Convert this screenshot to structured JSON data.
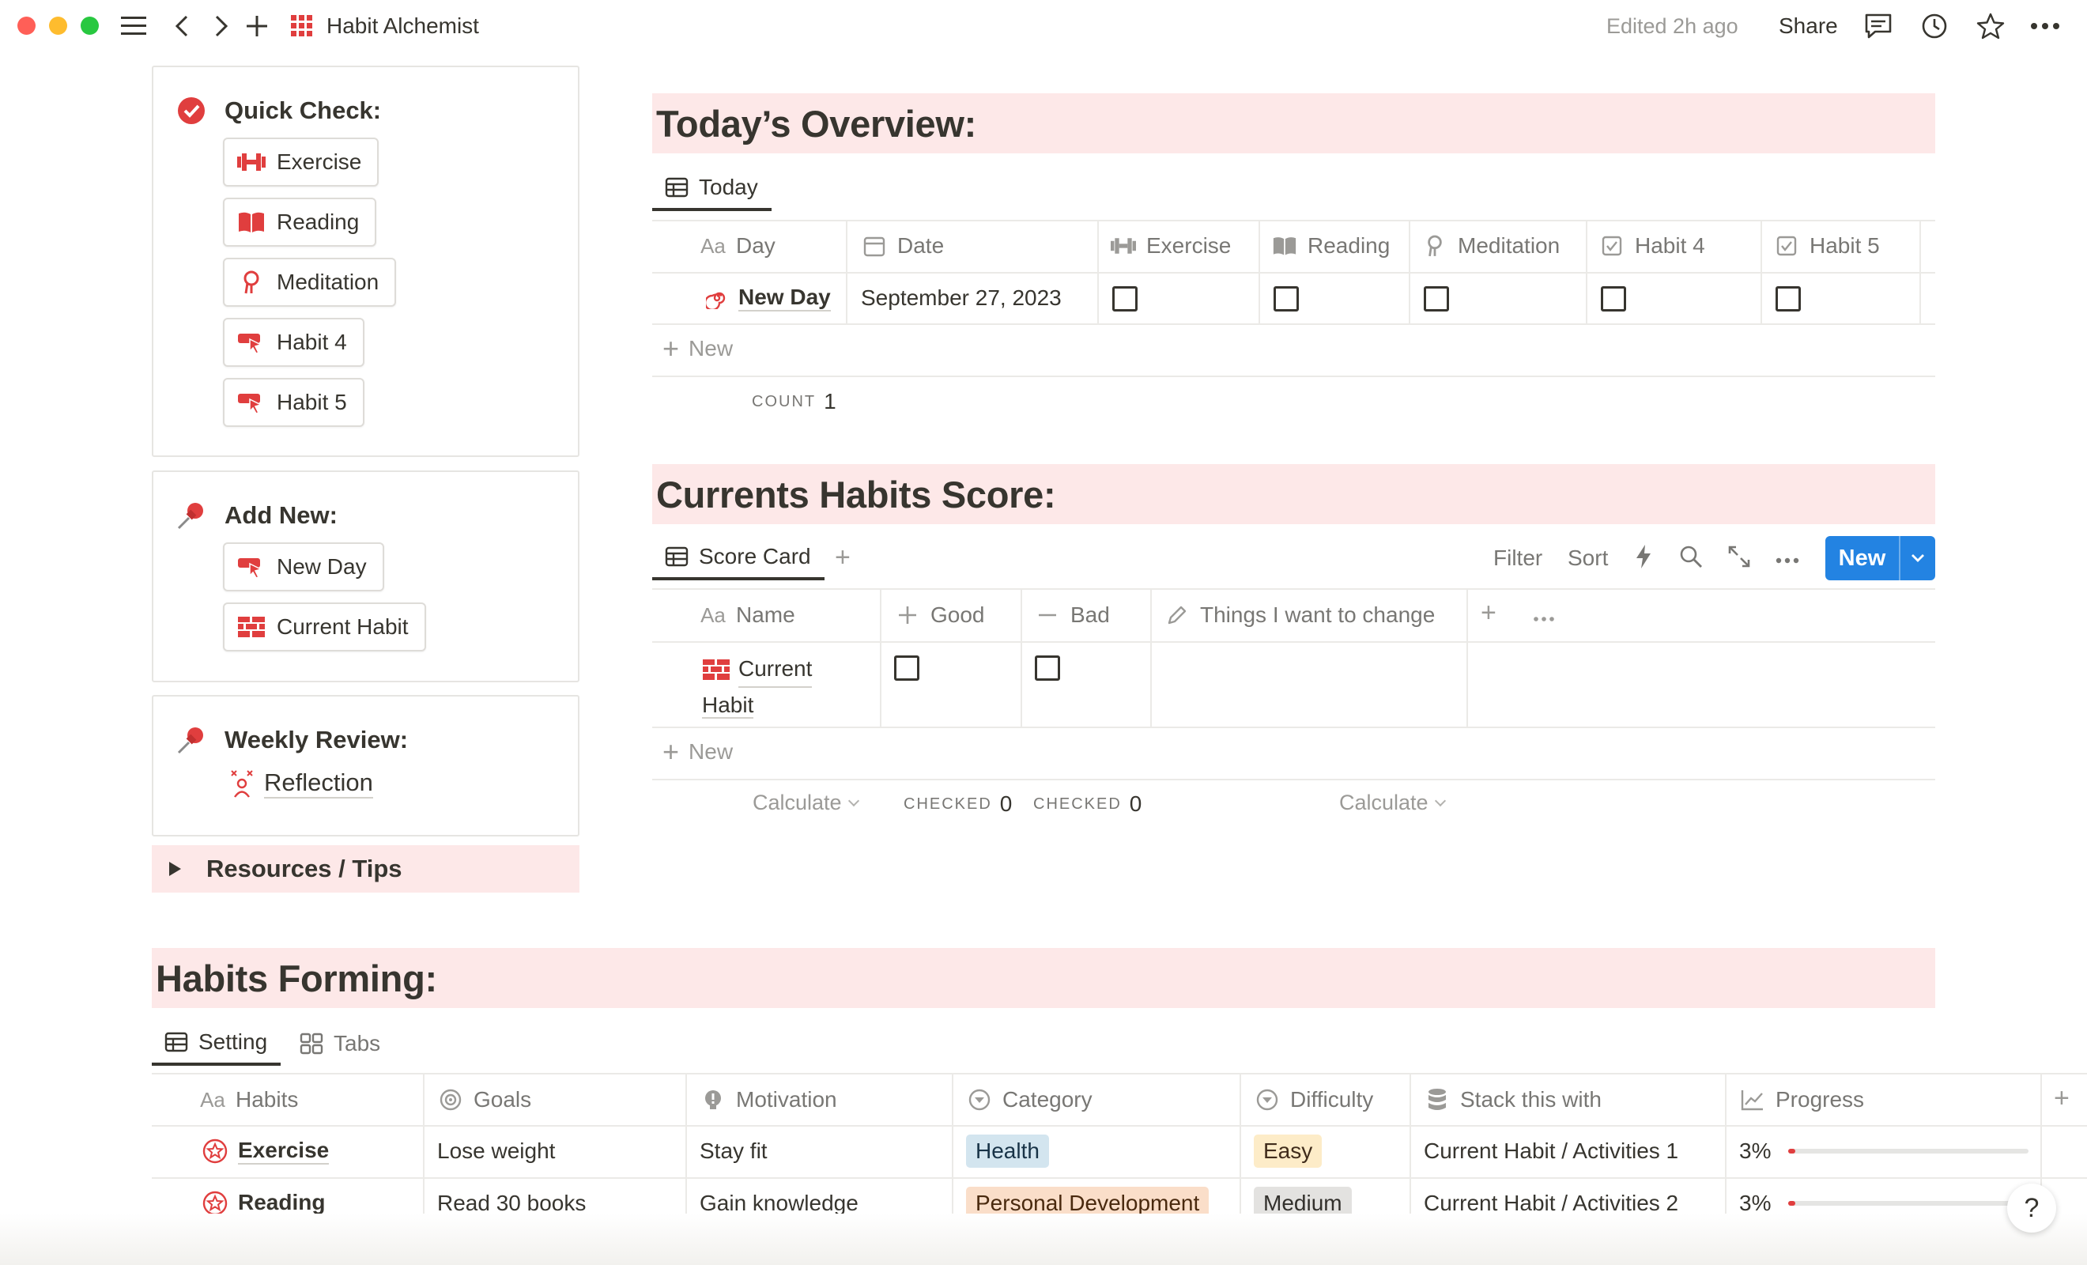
{
  "titlebar": {
    "title": "Habit Alchemist",
    "edited": "Edited 2h ago",
    "share": "Share",
    "icons": [
      "menu-icon",
      "back-icon",
      "forward-icon",
      "plus-icon",
      "grid-icon",
      "comment-icon",
      "history-icon",
      "star-icon",
      "more-icon"
    ]
  },
  "sidebar": {
    "quick_check": {
      "title": "Quick Check:",
      "buttons": [
        "Exercise",
        "Reading",
        "Meditation",
        "Habit 4",
        "Habit 5"
      ]
    },
    "add_new": {
      "title": "Add New:",
      "buttons": [
        "New Day",
        "Current Habit"
      ]
    },
    "weekly_review": {
      "title": "Weekly Review:",
      "link": "Reflection"
    },
    "resources": "Resources / Tips"
  },
  "overview": {
    "heading": "Today’s Overview:",
    "tab": "Today",
    "columns": [
      "Day",
      "Date",
      "Exercise",
      "Reading",
      "Meditation",
      "Habit 4",
      "Habit 5"
    ],
    "row": {
      "day": "New Day",
      "date": "September 27, 2023"
    },
    "new_label": "New",
    "count_label": "COUNT",
    "count_value": "1"
  },
  "score": {
    "heading": "Currents Habits Score:",
    "tab": "Score Card",
    "toolbar": {
      "filter": "Filter",
      "sort": "Sort",
      "new": "New"
    },
    "columns": [
      "Name",
      "Good",
      "Bad",
      "Things I want to change"
    ],
    "row": {
      "name_line1": "Current",
      "name_line2": "Habit"
    },
    "new_label": "New",
    "calc_label": "Calculate",
    "checked_label": "CHECKED",
    "good_checked": "0",
    "bad_checked": "0"
  },
  "forming": {
    "heading": "Habits Forming:",
    "tabs": [
      "Setting",
      "Tabs"
    ],
    "columns": [
      "Habits",
      "Goals",
      "Motivation",
      "Category",
      "Difficulty",
      "Stack this with",
      "Progress"
    ],
    "rows": [
      {
        "habit": "Exercise",
        "goal": "Lose weight",
        "motivation": "Stay fit",
        "category": "Health",
        "difficulty": "Easy",
        "stack": "Current Habit / Activities 1",
        "progress": "3%",
        "progress_value": 0.03
      },
      {
        "habit": "Reading",
        "goal": "Read 30 books",
        "motivation": "Gain knowledge",
        "category": "Personal Development",
        "difficulty": "Medium",
        "stack": "Current Habit / Activities 2",
        "progress": "3%",
        "progress_value": 0.03
      }
    ]
  },
  "help": "?",
  "colors": {
    "accent_red": "#e03e3e",
    "heading_bg": "#fde8e8",
    "primary_blue": "#2383e2",
    "tag_health": "#d3e5ef",
    "tag_personal": "#fadec9",
    "tag_easy": "#fdecc8",
    "tag_medium": "#e3e2e0"
  }
}
